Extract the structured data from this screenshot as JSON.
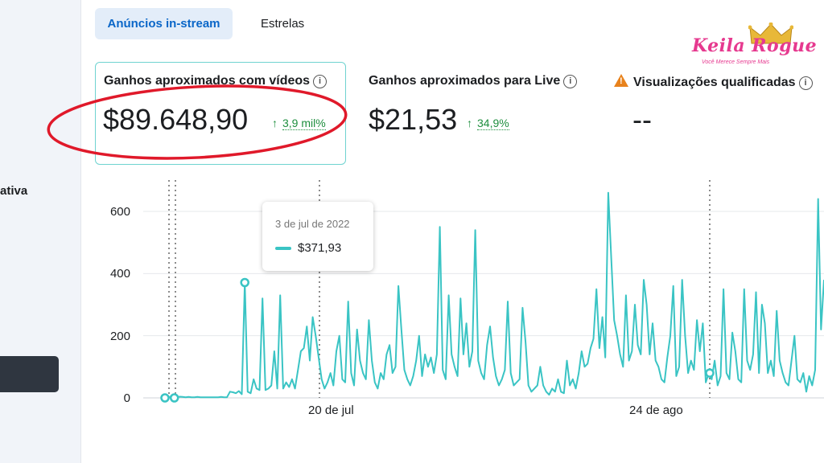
{
  "sidebar": {
    "partial_label": "ativa"
  },
  "tabs": [
    {
      "label": "Anúncios in-stream",
      "active": true
    },
    {
      "label": "Estrelas",
      "active": false
    }
  ],
  "metrics": [
    {
      "title": "Ganhos aproximados com vídeos",
      "value": "$89.648,90",
      "delta": "3,9 mil%",
      "selected": true
    },
    {
      "title": "Ganhos aproximados para Live",
      "value": "$21,53",
      "delta": "34,9%",
      "selected": false
    },
    {
      "title": "Visualizações qualificadas",
      "value": "--",
      "warning": true
    }
  ],
  "icons": {
    "info": "info-icon",
    "warning": "warning-icon",
    "delta": "arrow-up-icon"
  },
  "logo": {
    "text": "Keila Rogue",
    "tagline": "Você Merece Sempre Mais"
  },
  "tooltip": {
    "date": "3 de jul de 2022",
    "value": "$371,93"
  },
  "colors": {
    "series": "#3ac4c4",
    "delta": "#1e8e3e",
    "tab_active": "#0a66c8",
    "highlight_circle": "#e0192a",
    "card_border": "#6fd3d0"
  },
  "chart_data": {
    "type": "line",
    "y_ticks": [
      "600",
      "400",
      "200",
      "0"
    ],
    "x_ticks": [
      "20 de jul",
      "24 de ago"
    ],
    "ylim": [
      0,
      700
    ],
    "grid": true,
    "series": [
      {
        "values": [
          0,
          0,
          5,
          3,
          2,
          4,
          3,
          2,
          3,
          2,
          2,
          3,
          2,
          2,
          2,
          2,
          2,
          2,
          2,
          3,
          2,
          2,
          20,
          18,
          15,
          22,
          12,
          371,
          20,
          15,
          60,
          30,
          25,
          320,
          25,
          30,
          40,
          150,
          30,
          330,
          30,
          50,
          35,
          60,
          30,
          90,
          150,
          160,
          230,
          120,
          260,
          200,
          130,
          60,
          30,
          50,
          80,
          40,
          150,
          200,
          60,
          50,
          310,
          80,
          40,
          220,
          120,
          80,
          60,
          250,
          120,
          50,
          30,
          80,
          60,
          140,
          170,
          80,
          100,
          360,
          220,
          90,
          60,
          40,
          70,
          120,
          200,
          70,
          140,
          100,
          130,
          80,
          140,
          550,
          90,
          60,
          330,
          140,
          100,
          70,
          320,
          140,
          240,
          100,
          150,
          540,
          120,
          80,
          60,
          170,
          230,
          130,
          70,
          40,
          60,
          90,
          310,
          80,
          40,
          50,
          60,
          290,
          180,
          40,
          20,
          30,
          40,
          100,
          40,
          20,
          10,
          30,
          20,
          60,
          20,
          15,
          120,
          40,
          60,
          30,
          80,
          150,
          100,
          110,
          160,
          190,
          350,
          160,
          260,
          130,
          660,
          450,
          250,
          200,
          140,
          100,
          330,
          120,
          150,
          300,
          170,
          140,
          380,
          300,
          140,
          240,
          120,
          100,
          60,
          50,
          130,
          200,
          360,
          70,
          100,
          380,
          200,
          80,
          120,
          90,
          250,
          150,
          240,
          50,
          80,
          60,
          120,
          40,
          70,
          350,
          80,
          60,
          210,
          150,
          60,
          50,
          350,
          120,
          90,
          140,
          340,
          80,
          300,
          240,
          80,
          120,
          70,
          280,
          120,
          80,
          50,
          40,
          120,
          200,
          60,
          50,
          80,
          20,
          70,
          40,
          90,
          640,
          220,
          380
        ]
      }
    ]
  }
}
